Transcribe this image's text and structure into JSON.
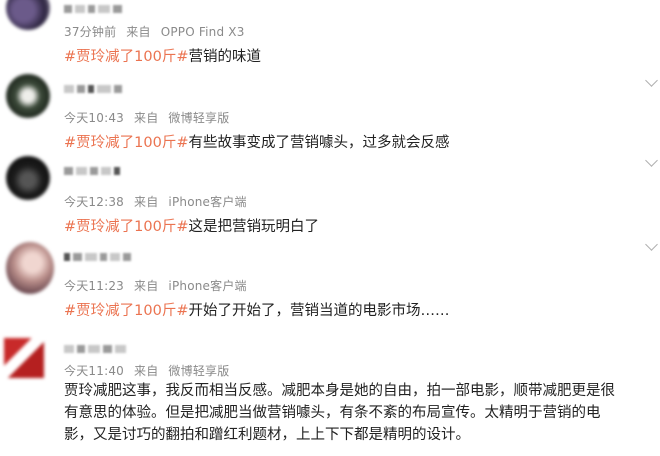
{
  "comments": [
    {
      "time": "37分钟前",
      "source_prefix": "来自",
      "source": "OPPO Find X3",
      "hashtag": "#贾玲减了100斤#",
      "text": "营销的味道"
    },
    {
      "time": "今天10:43",
      "source_prefix": "来自",
      "source": "微博轻享版",
      "hashtag": "#贾玲减了100斤#",
      "text": "有些故事变成了营销噱头，过多就会反感"
    },
    {
      "time": "今天12:38",
      "source_prefix": "来自",
      "source": "iPhone客户端",
      "hashtag": "#贾玲减了100斤#",
      "text": "这是把营销玩明白了"
    },
    {
      "time": "今天11:23",
      "source_prefix": "来自",
      "source": "iPhone客户端",
      "hashtag": "#贾玲减了100斤#",
      "text": "开始了开始了，营销当道的电影市场……"
    },
    {
      "time": "今天11:40",
      "source_prefix": "来自",
      "source": "微博轻享版",
      "lines": [
        "贾玲减肥这事，我反而相当反感。减肥本身是她的自由，拍一部电影，顺带减肥更是很",
        "有意思的体验。但是把减肥当做营销噱头，有条不紊的布局宣传。太精明于营销的电",
        "影，又是讨巧的翻拍和蹭红利题材，上上下下都是精明的设计。"
      ]
    }
  ],
  "colors": {
    "hashtag": "#eb7350",
    "meta": "#8a8a8a",
    "text": "#222222"
  }
}
